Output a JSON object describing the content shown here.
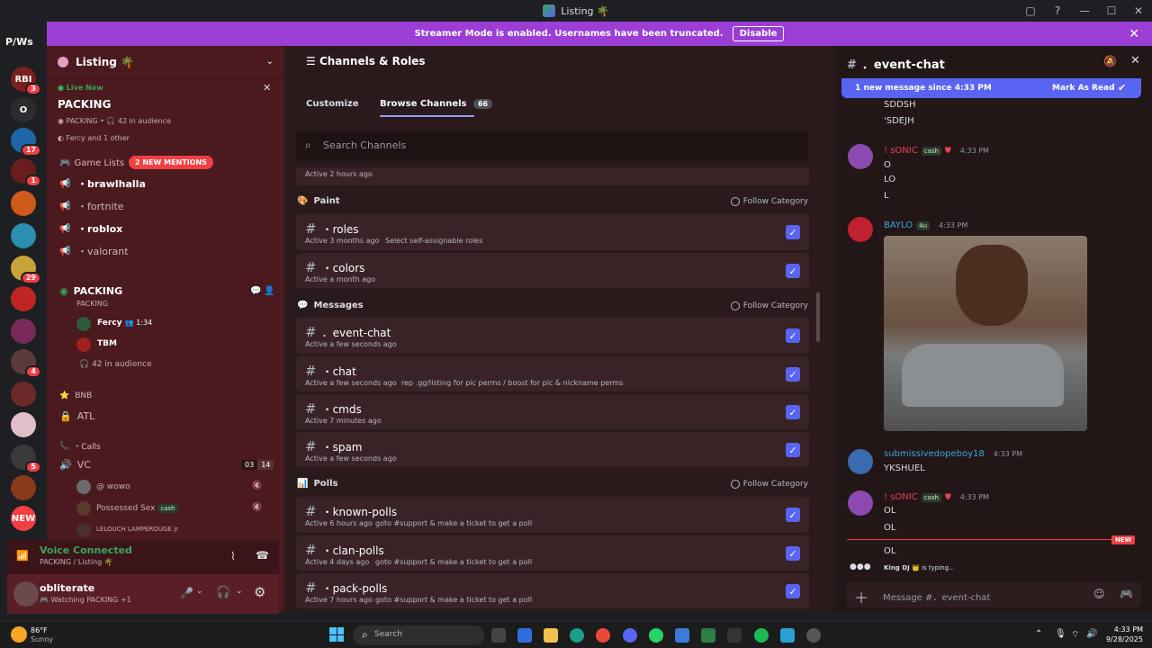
{
  "window": {
    "title": "Listing 🌴",
    "controls": [
      "▢",
      "?",
      "—",
      "☐",
      "✕"
    ]
  },
  "banner": {
    "text": "Streamer Mode is enabled. Usernames have been truncated.",
    "disable_label": "Disable"
  },
  "rail": {
    "top_label": "P/Ws",
    "servers": [
      {
        "label": "RBI",
        "color": "#7a1f1f",
        "badge": "3"
      },
      {
        "label": "O",
        "color": "#2b2d31",
        "badge": ""
      },
      {
        "label": "",
        "color": "#1e66a8",
        "badge": "17"
      },
      {
        "label": "",
        "color": "#6b1d1d",
        "badge": "1"
      },
      {
        "label": "",
        "color": "#d05a1a",
        "badge": ""
      },
      {
        "label": "",
        "color": "#2a8fb0",
        "badge": ""
      },
      {
        "label": "",
        "color": "#c8a33a",
        "badge": "29"
      },
      {
        "label": "",
        "color": "#c02525",
        "badge": ""
      },
      {
        "label": "",
        "color": "#7a2a5a",
        "badge": ""
      },
      {
        "label": "",
        "color": "#5a3a3a",
        "badge": "4"
      },
      {
        "label": "",
        "color": "#6a2a2a",
        "badge": ""
      },
      {
        "label": "",
        "color": "#e0c0c8",
        "badge": ""
      },
      {
        "label": "",
        "color": "#3a3a3a",
        "badge": "5"
      },
      {
        "label": "",
        "color": "#8a3a1a",
        "badge": ""
      },
      {
        "label": "NEW",
        "color": "#f23f43",
        "badge": ""
      }
    ]
  },
  "sidebar": {
    "server_name": "Listing 🌴",
    "live": {
      "badge": "Live Now",
      "title": "PACKING",
      "detail": "PACKING • 🎧 42 in audience",
      "friends": "Fercy and 1 other"
    },
    "game_lists": {
      "label": "Game Lists",
      "mentions": "2 NEW MENTIONS"
    },
    "channels": [
      {
        "name": "・brawlhalla",
        "bold": true
      },
      {
        "name": "・fortnite",
        "bold": false
      },
      {
        "name": "・roblox",
        "bold": true
      },
      {
        "name": "・valorant",
        "bold": false
      }
    ],
    "stage": {
      "name": "PACKING",
      "sub": "PACKING",
      "users": [
        {
          "name": "Fercy",
          "extra": "👥 1:34"
        },
        {
          "name": "TBM",
          "extra": ""
        }
      ],
      "audience": "42 in audience"
    },
    "bnb": "BNB",
    "atl": "ATL",
    "calls": "・Calls",
    "vc": {
      "name": "VC",
      "count_a": "03",
      "count_b": "14"
    },
    "vc_users": [
      {
        "name": "@ wowo"
      },
      {
        "name": "Possessed Sex"
      },
      {
        "name": "LELOUCH LAMPEROUGE jr"
      }
    ],
    "cash_tag": "cash",
    "voice": {
      "status": "Voice Connected",
      "detail": "PACKING / Listing 🌴"
    },
    "user": {
      "name": "obliterate",
      "status": "Watching PACKING +1"
    }
  },
  "main": {
    "title": "Channels & Roles",
    "tabs": [
      {
        "label": "Customize"
      },
      {
        "label": "Browse Channels",
        "count": "66"
      }
    ],
    "search_placeholder": "Search Channels",
    "top_activity": "Active 2 hours ago",
    "follow_label": "Follow Category",
    "categories": [
      {
        "name": "Paint",
        "rows": [
          {
            "name": "・roles",
            "activity": "Active 3 months ago",
            "desc": "Select self-assignable roles"
          },
          {
            "name": "・colors",
            "activity": "Active a month ago",
            "desc": ""
          }
        ]
      },
      {
        "name": "Messages",
        "rows": [
          {
            "name": "．event-chat",
            "activity": "Active a few seconds ago",
            "desc": ""
          },
          {
            "name": "・chat",
            "activity": "Active a few seconds ago",
            "desc": "rep .gg/listing for pic perms / boost for pic & nickname perms"
          },
          {
            "name": "・cmds",
            "activity": "Active 7 minutes ago",
            "desc": ""
          },
          {
            "name": "・spam",
            "activity": "Active a few seconds ago",
            "desc": ""
          }
        ]
      },
      {
        "name": "Polls",
        "rows": [
          {
            "name": "・known-polls",
            "activity": "Active 6 hours ago",
            "desc": "goto #support & make a ticket to get a poll"
          },
          {
            "name": "・clan-polls",
            "activity": "Active 4 days ago",
            "desc": "goto #support & make a ticket to get a poll"
          },
          {
            "name": "・pack-polls",
            "activity": "Active 7 hours ago",
            "desc": "goto #support & make a ticket to get a poll"
          }
        ]
      }
    ]
  },
  "chat": {
    "channel": "．event-chat",
    "new_bar": {
      "text": "1 new message since 4:33 PM",
      "action": "Mark As Read"
    },
    "top_lines": [
      "SDDSH",
      "'SDEJH"
    ],
    "messages": [
      {
        "author": "! sONIC",
        "tag": "cash",
        "time": "4:33 PM",
        "lines": [
          "O",
          "LO",
          "L"
        ],
        "color": "#e8425a"
      },
      {
        "author": "BAYLO",
        "tag": "4u",
        "time": "4:33 PM",
        "lines": [],
        "color": "#3ba5e0"
      },
      {
        "author": "submissivedopeboy18",
        "tag": "",
        "time": "4:33 PM",
        "lines": [
          "YKSHUEL"
        ],
        "color": "#3ba5e0"
      },
      {
        "author": "! sONIC",
        "tag": "cash",
        "time": "4:33 PM",
        "lines": [
          "OL",
          "OL"
        ],
        "color": "#e8425a"
      }
    ],
    "new_label": "NEW",
    "last_line": "OL",
    "typing_user": "King DJ 👑",
    "typing_text": "is typing...",
    "input_placeholder": "Message #．event-chat"
  },
  "taskbar": {
    "weather": {
      "temp": "86°F",
      "cond": "Sunny"
    },
    "search": "Search",
    "time": "4:33 PM",
    "date": "9/28/2025"
  }
}
